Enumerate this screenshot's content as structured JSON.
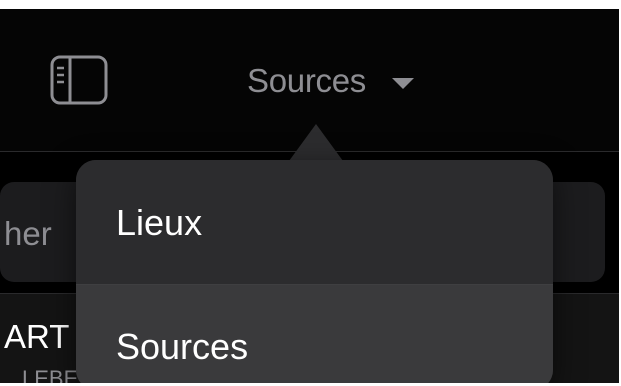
{
  "navbar": {
    "title": "Sources",
    "sidebar_icon": "sidebar-icon",
    "caret_icon": "triangle-down-icon"
  },
  "background": {
    "search_text_fragment": "her",
    "row_title_fragment": "ART",
    "row_subtitle_fragment": "LEBE"
  },
  "menu": {
    "items": [
      {
        "label": "Lieux",
        "selected": false
      },
      {
        "label": "Sources",
        "selected": true
      }
    ]
  },
  "colors": {
    "background": "#000000",
    "navbar": "#050505",
    "popover": "#2c2c2e",
    "highlight": "#3a3a3c",
    "secondary_text": "#8e8e93",
    "primary_text": "#ffffff"
  }
}
